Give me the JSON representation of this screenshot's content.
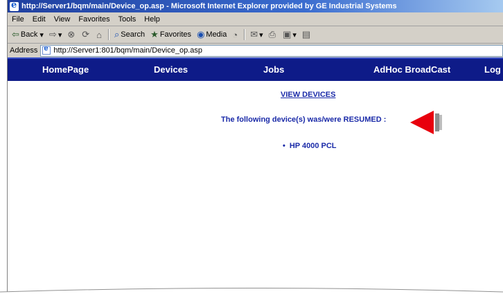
{
  "window": {
    "title": "http://Server1/bqm/main/Device_op.asp - Microsoft Internet Explorer provided by GE Industrial Systems"
  },
  "menu": [
    "File",
    "Edit",
    "View",
    "Favorites",
    "Tools",
    "Help"
  ],
  "toolbar": {
    "back": "Back",
    "search": "Search",
    "favorites": "Favorites",
    "media": "Media"
  },
  "address": {
    "label": "Address",
    "url": "http://Server1:801/bqm/main/Device_op.asp"
  },
  "nav": {
    "items": [
      "HomePage",
      "Devices",
      "Jobs",
      "AdHoc BroadCast",
      "Log"
    ]
  },
  "main": {
    "view_devices_link": "VIEW DEVICES",
    "message": "The following device(s) was/were RESUMED :",
    "devices": [
      "HP 4000 PCL"
    ],
    "bullet": "•"
  },
  "colors": {
    "nav_bg": "#0e1b88",
    "text_blue": "#1a2aa8",
    "arrow_red": "#e8000d"
  }
}
